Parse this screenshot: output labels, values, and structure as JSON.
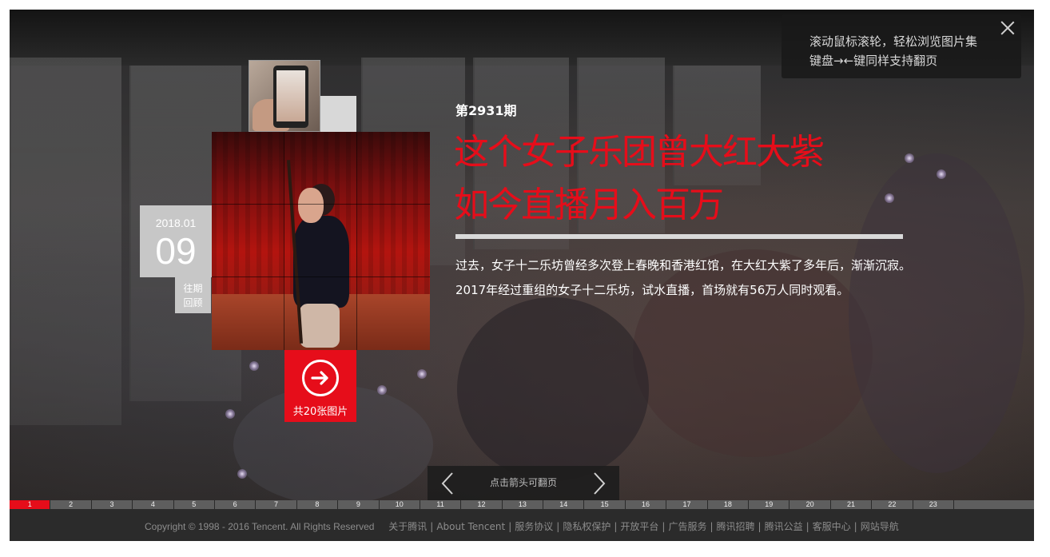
{
  "hint": {
    "line1": "滚动鼠标滚轮，轻松浏览图片集",
    "line2": "键盘→←键同样支持翻页"
  },
  "date": {
    "year_month": "2018.01",
    "day": "09"
  },
  "past_button": {
    "line1": "往期",
    "line2": "回顾"
  },
  "count_button": {
    "label": "共20张图片"
  },
  "article": {
    "issue": "第2931期",
    "title_line1": "这个女子乐团曾大红大紫",
    "title_line2": "如今直播月入百万",
    "description": "过去，女子十二乐坊曾经多次登上春晚和香港红馆，在大红大紫了多年后，渐渐沉寂。2017年经过重组的女子十二乐坊，试水直播，首场就有56万人同时观看。"
  },
  "pager": {
    "hint": "点击箭头可翻页"
  },
  "page_strip": {
    "active": 1,
    "pages": [
      "1",
      "2",
      "3",
      "4",
      "5",
      "6",
      "7",
      "8",
      "9",
      "10",
      "11",
      "12",
      "13",
      "14",
      "15",
      "16",
      "17",
      "18",
      "19",
      "20",
      "21",
      "22",
      "23"
    ]
  },
  "footer": {
    "copyright": "Copyright © 1998 - 2016 Tencent. All Rights Reserved",
    "links": [
      "关于腾讯",
      "About Tencent",
      "服务协议",
      "隐私权保护",
      "开放平台",
      "广告服务",
      "腾讯招聘",
      "腾讯公益",
      "客服中心",
      "网站导航"
    ]
  },
  "colors": {
    "accent": "#e60d1a",
    "panel_grey": "#c7c7c7",
    "footer_bg": "#2b2b2b"
  }
}
